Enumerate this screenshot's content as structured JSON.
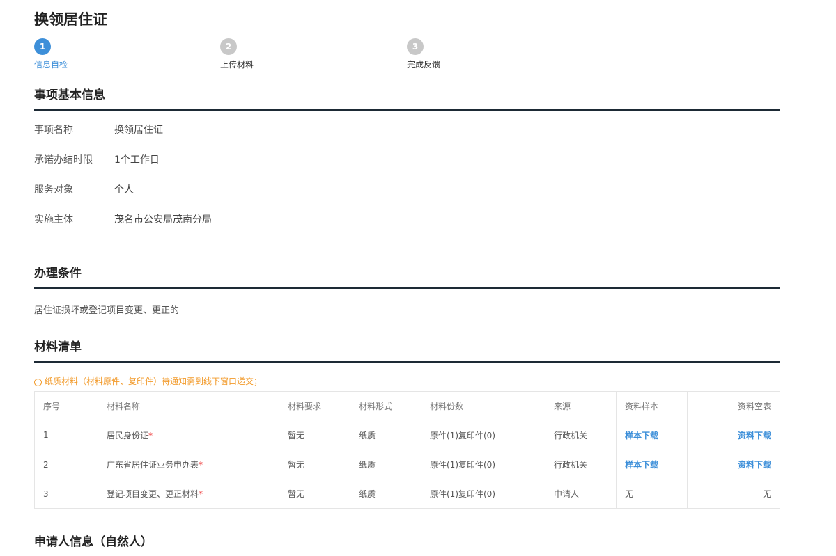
{
  "title": "换领居住证",
  "steps": [
    {
      "num": "1",
      "label": "信息自检"
    },
    {
      "num": "2",
      "label": "上传材料"
    },
    {
      "num": "3",
      "label": "完成反馈"
    }
  ],
  "basic": {
    "heading": "事项基本信息",
    "rows": [
      {
        "label": "事项名称",
        "value": "换领居住证"
      },
      {
        "label": "承诺办结时限",
        "value": "1个工作日"
      },
      {
        "label": "服务对象",
        "value": "个人"
      },
      {
        "label": "实施主体",
        "value": "茂名市公安局茂南分局"
      }
    ]
  },
  "conditions": {
    "heading": "办理条件",
    "text": "居住证损坏或登记项目变更、更正的"
  },
  "materials": {
    "heading": "材料清单",
    "notice_icon": "info-circle-icon",
    "notice": "纸质材料（材料原件、复印件）待通知需到线下窗口递交；",
    "headers": [
      "序号",
      "材料名称",
      "材料要求",
      "材料形式",
      "材料份数",
      "来源",
      "资料样本",
      "资料空表"
    ],
    "rows": [
      {
        "no": "1",
        "name": "居民身份证",
        "req": "*",
        "requirement": "暂无",
        "form": "纸质",
        "copies": "原件(1)复印件(0)",
        "source": "行政机关",
        "sample": "样本下载",
        "blank": "资料下载"
      },
      {
        "no": "2",
        "name": "广东省居住证业务申办表",
        "req": "*",
        "requirement": "暂无",
        "form": "纸质",
        "copies": "原件(1)复印件(0)",
        "source": "行政机关",
        "sample": "样本下载",
        "blank": "资料下载"
      },
      {
        "no": "3",
        "name": "登记项目变更、更正材料",
        "req": "*",
        "requirement": "暂无",
        "form": "纸质",
        "copies": "原件(1)复印件(0)",
        "source": "申请人",
        "sample": "无",
        "blank": "无"
      }
    ]
  },
  "applicant": {
    "heading": "申请人信息（自然人）"
  }
}
